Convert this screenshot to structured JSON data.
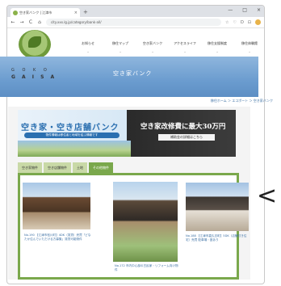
{
  "browser": {
    "tab_title": "空き家バンク | 江津市",
    "tab_close": "×",
    "new_tab": "+",
    "win_controls": [
      "—",
      "□",
      "×"
    ],
    "url": "city.xxx.lg.jp/category/bank-all/",
    "nav": {
      "back": "←",
      "forward": "→",
      "reload": "C",
      "home": "⌂"
    },
    "extensions": [
      "☆",
      "♡",
      "D",
      "⊡"
    ]
  },
  "site": {
    "brand_line1": "G O K O",
    "brand_line2": "G A I S A",
    "menu": [
      {
        "label": "お知らせ"
      },
      {
        "label": "移住マップ"
      },
      {
        "label": "空き家バンク"
      },
      {
        "label": "アクセスライフ"
      },
      {
        "label": "移住支援制度"
      },
      {
        "label": "移住体験館"
      }
    ],
    "menu_chevron": "⌄",
    "hero_title": "空き家バンク",
    "breadcrumb": "移住ホーム ＞ エコポート ＞ 空き家バンク"
  },
  "banner": {
    "title_left": "空き家・空き店舗バンク",
    "subtitle_left": "物件情報は移住者と地域を結ぶ情報です",
    "title_right": "空き家改修費に最大30万円",
    "subtitle_right": "補助金の詳細はこちら"
  },
  "category_tabs": [
    "空き家物件",
    "空き店舗物件",
    "土地",
    "その他物件"
  ],
  "listings": [
    {
      "text": "No.190 【江津市松川町】4DK（賃貸）売買「どなたか住んでいただける方募集」賃貸可能物件"
    },
    {
      "text": "No.172 市内中心部の古民家・リフォーム向け物件"
    },
    {
      "text": "No.188 【江津市嘉久志町】5DK（店舗付き住宅）売買 駐車場・庭あり"
    }
  ],
  "annotation": {
    "arrow": "<"
  },
  "colors": {
    "accent_green": "#7aa84c",
    "hero_blue": "#6b9ccf",
    "link_blue": "#3b6fa3"
  },
  "icons": {
    "logo": "leaf-logo-icon",
    "favicon": "site-favicon-icon"
  }
}
